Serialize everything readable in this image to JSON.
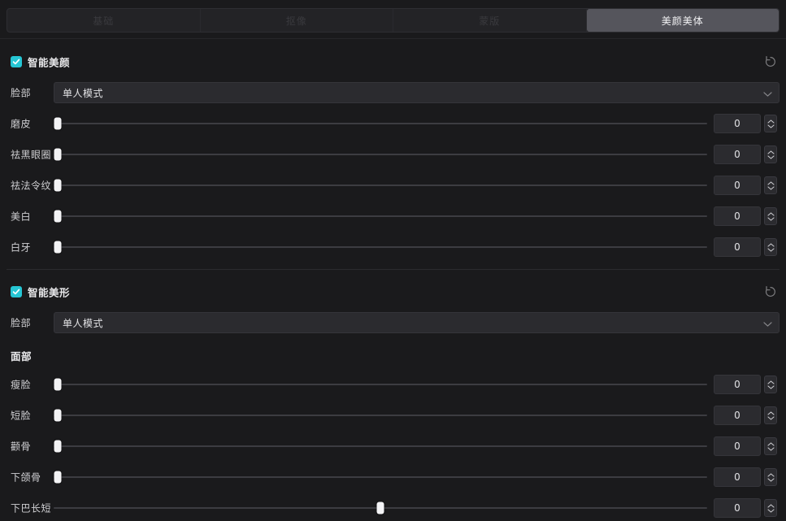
{
  "tabs": [
    {
      "label": "基础",
      "active": false
    },
    {
      "label": "抠像",
      "active": false
    },
    {
      "label": "蒙版",
      "active": false
    },
    {
      "label": "美颜美体",
      "active": true
    }
  ],
  "sections": [
    {
      "title": "智能美颜",
      "checked": true,
      "reset_icon": "reset-icon",
      "mode": {
        "label": "脸部",
        "value": "单人模式",
        "caret_icon": "chevron-down-icon"
      },
      "sliders": [
        {
          "label": "磨皮",
          "value": "0",
          "percent": 0
        },
        {
          "label": "祛黑眼圈",
          "value": "0",
          "percent": 0
        },
        {
          "label": "祛法令纹",
          "value": "0",
          "percent": 0
        },
        {
          "label": "美白",
          "value": "0",
          "percent": 0
        },
        {
          "label": "白牙",
          "value": "0",
          "percent": 0
        }
      ]
    },
    {
      "title": "智能美形",
      "checked": true,
      "reset_icon": "reset-icon",
      "mode": {
        "label": "脸部",
        "value": "单人模式",
        "caret_icon": "chevron-down-icon"
      },
      "group_heading": "面部",
      "sliders": [
        {
          "label": "瘦脸",
          "value": "0",
          "percent": 0
        },
        {
          "label": "短脸",
          "value": "0",
          "percent": 0
        },
        {
          "label": "颧骨",
          "value": "0",
          "percent": 0
        },
        {
          "label": "下颌骨",
          "value": "0",
          "percent": 0
        },
        {
          "label": "下巴长短",
          "value": "0",
          "percent": 50
        }
      ]
    }
  ],
  "colors": {
    "background": "#1a1a1c",
    "accent": "#26c6d4",
    "tab_active_bg": "#55555c",
    "track": "#3c3c41",
    "handle": "#f3f3f5"
  }
}
